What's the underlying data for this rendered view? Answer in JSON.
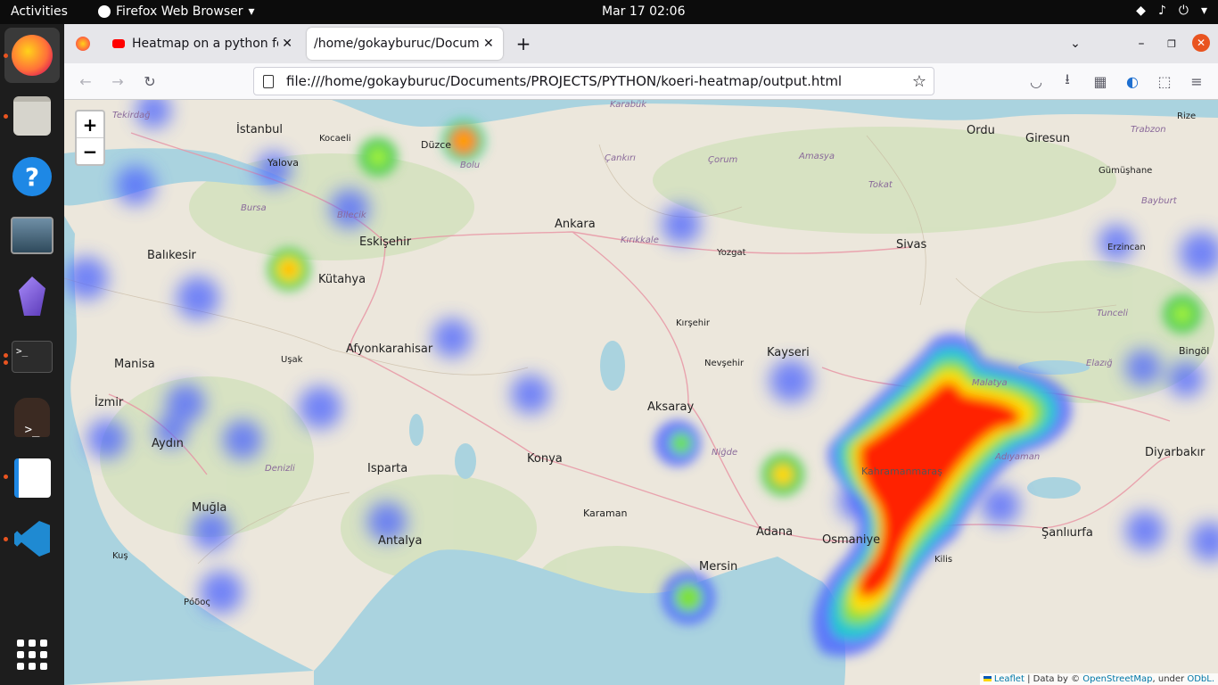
{
  "topbar": {
    "activities": "Activities",
    "app": "Firefox Web Browser",
    "clock": "Mar 17  02:06"
  },
  "dock": {
    "icons": [
      "firefox-icon",
      "files-icon",
      "help-icon",
      "media-icon",
      "obsidian-icon",
      "terminal-icon",
      "gnome-terminal-icon",
      "text-editor-icon",
      "vscode-icon",
      "app-grid-icon"
    ]
  },
  "browser": {
    "tabs": [
      {
        "title": "Heatmap on a python foli"
      },
      {
        "title": "/home/gokayburuc/Docume"
      }
    ],
    "url": "file:///home/gokayburuc/Documents/PROJECTS/PYTHON/koeri-heatmap/output.html"
  },
  "map": {
    "zoom_in": "+",
    "zoom_out": "−",
    "attribution": {
      "leaflet": "Leaflet",
      "data": " | Data by © ",
      "osm": "OpenStreetMap",
      "under": ", under ",
      "odbl": "ODbL."
    },
    "cities": [
      "İstanbul",
      "Kocaeli",
      "Düzce",
      "Bolu",
      "Yalova",
      "Bursa",
      "Bilecik",
      "Eskişehir",
      "Ankara",
      "Balıkesir",
      "Kütahya",
      "Afyonkarahisar",
      "Manisa",
      "İzmir",
      "Aydın",
      "Denizli",
      "Uşak",
      "Isparta",
      "Konya",
      "Aksaray",
      "Muğla",
      "Antalya",
      "Karaman",
      "Mersin",
      "Adana",
      "Osmaniye",
      "Kayseri",
      "Nevşehir",
      "Kırşehir",
      "Yozgat",
      "Sivas",
      "Tokat",
      "Amasya",
      "Çorum",
      "Ordu",
      "Giresun",
      "Gümüşhane",
      "Bayburt",
      "Erzincan",
      "Tunceli",
      "Elazığ",
      "Bingöl",
      "Diyarbakır",
      "Şanlıurfa",
      "Kilis",
      "Rize",
      "Trabzon",
      "Kahramanmaraş",
      "Malatya",
      "Adıyaman",
      "Niğde",
      "Kırıkkale",
      "Çankırı",
      "Karabük",
      "Tekirdağ",
      "Kuş",
      "Ρόδος"
    ]
  }
}
